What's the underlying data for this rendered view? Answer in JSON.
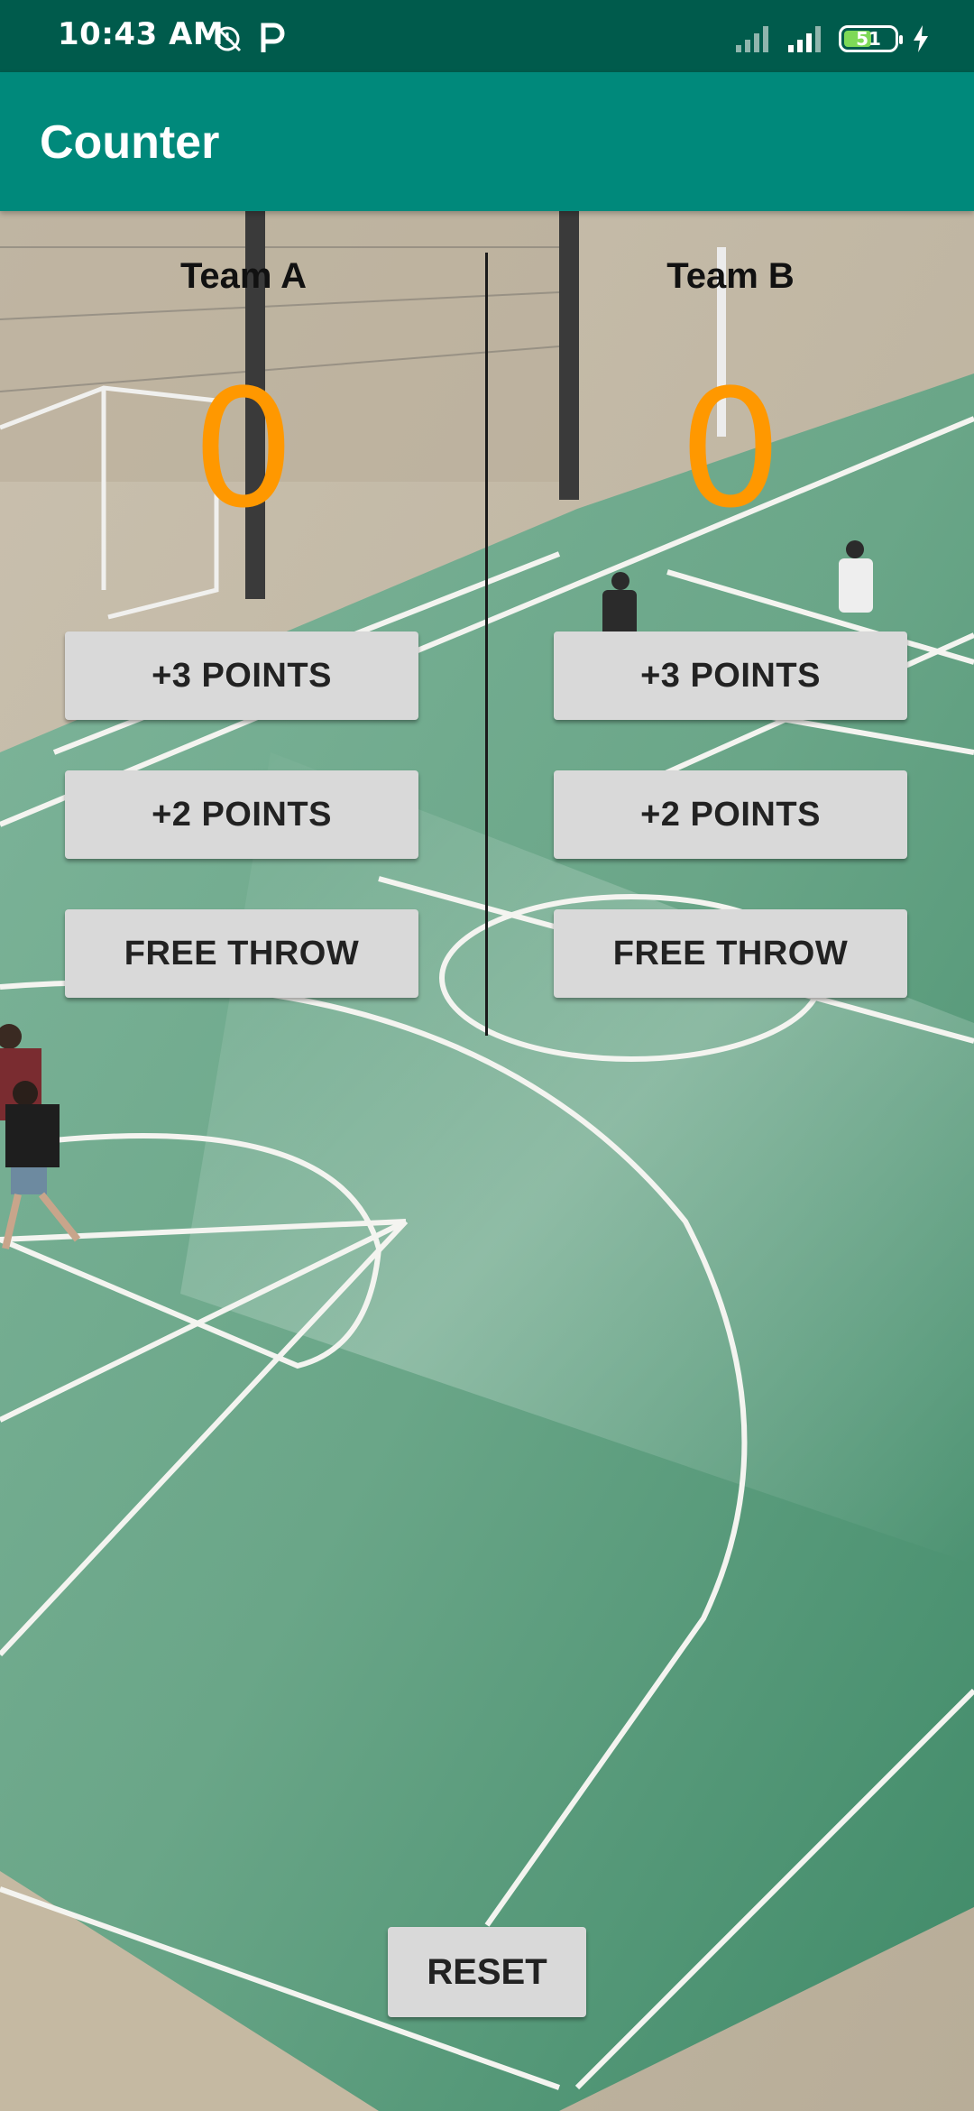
{
  "status_bar": {
    "time": "10:43 AM",
    "battery": "51",
    "icons": [
      "alarm-off-icon",
      "parking-icon",
      "signal-icon",
      "signal-icon",
      "battery-icon",
      "charging-icon"
    ]
  },
  "app_bar": {
    "title": "Counter"
  },
  "teams": [
    {
      "name": "Team A",
      "score": "0",
      "buttons": {
        "three": "+3 POINTS",
        "two": "+2 POINTS",
        "free": "FREE THROW"
      }
    },
    {
      "name": "Team B",
      "score": "0",
      "buttons": {
        "three": "+3 POINTS",
        "two": "+2 POINTS",
        "free": "FREE THROW"
      }
    }
  ],
  "reset_label": "RESET",
  "colors": {
    "status_bar": "#005b4c",
    "app_bar": "#00897b",
    "score": "#ff9800",
    "button": "#d9d9d9"
  }
}
